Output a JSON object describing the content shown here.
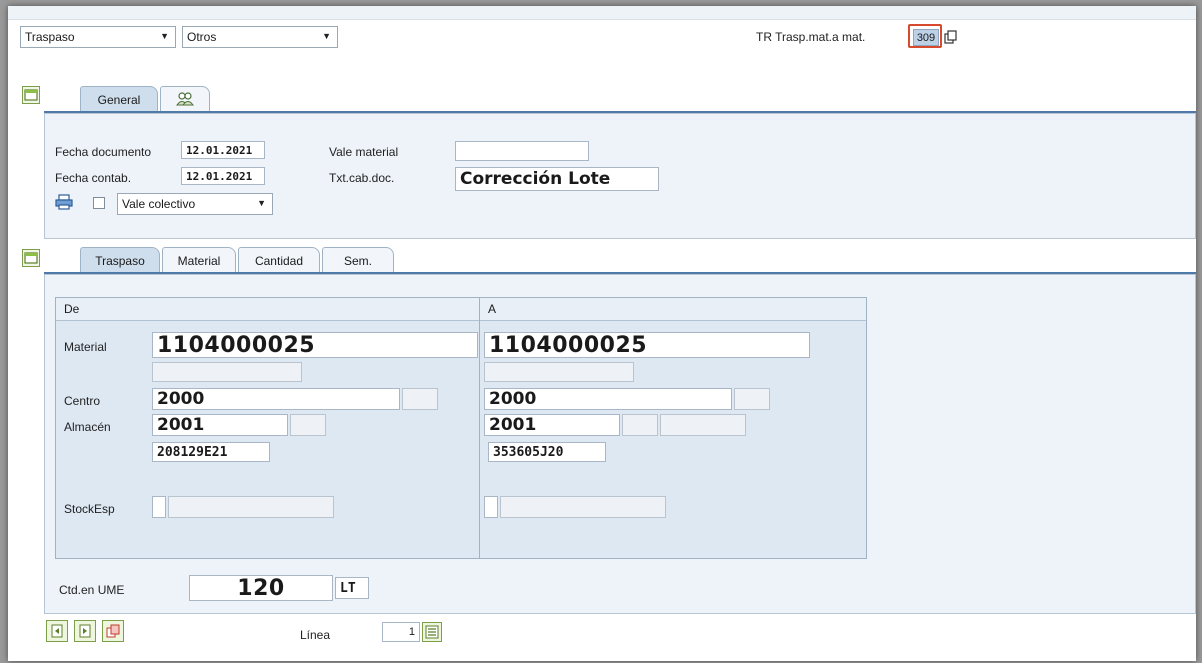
{
  "header": {
    "transaction_combo": "Traspaso",
    "reference_combo": "Otros",
    "movement_label": "TR Trasp.mat.a mat.",
    "movement_type": "309"
  },
  "general_tabs": [
    "General",
    ""
  ],
  "general": {
    "fecha_documento_label": "Fecha documento",
    "fecha_documento": "12.01.2021",
    "fecha_contab_label": "Fecha contab.",
    "fecha_contab": "12.01.2021",
    "vale_material_label": "Vale material",
    "vale_material": "",
    "txt_cab_label": "Txt.cab.doc.",
    "txt_cab": "Corrección Lote",
    "vale_select": "Vale colectivo"
  },
  "item_tabs": [
    "Traspaso",
    "Material",
    "Cantidad",
    "Sem."
  ],
  "from": {
    "header": "De",
    "material_label": "Material",
    "material": "1104000025",
    "centro_label": "Centro",
    "centro": "2000",
    "almacen_label": "Almacén",
    "almacen": "2001",
    "lote": "208129E21",
    "stock_label": "StockEsp"
  },
  "to": {
    "header": "A",
    "material": "1104000025",
    "centro": "2000",
    "almacen": "2001",
    "lote": "353605J20"
  },
  "quantity": {
    "label": "Ctd.en UME",
    "value": "120",
    "unit": "LT"
  },
  "footer": {
    "linea_label": "Línea",
    "linea_value": "1"
  },
  "colors": {
    "panel": "#edf3f9",
    "accent": "#4f7aa8",
    "highlight": "#d84a2e"
  }
}
